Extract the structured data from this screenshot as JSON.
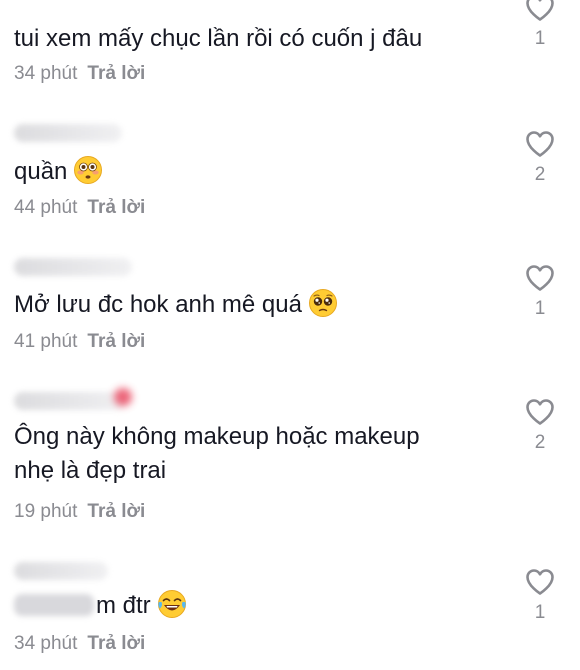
{
  "reply_label": "Trả lời",
  "comments": [
    {
      "text": "tui xem mấy chục lần rồi có cuốn j đâu",
      "time": "34 phút",
      "likes": "1",
      "emoji": ""
    },
    {
      "text": "quần",
      "time": "44 phút",
      "likes": "2",
      "emoji": "flushed-face"
    },
    {
      "text": "Mở lưu đc hok anh mê quá",
      "time": "41 phút",
      "likes": "1",
      "emoji": "pleading-face"
    },
    {
      "text": "Ông này không makeup hoặc makeup\nnhẹ là đẹp trai",
      "time": "19 phút",
      "likes": "2",
      "emoji": ""
    },
    {
      "text": "m đtr",
      "time": "34 phút",
      "likes": "1",
      "emoji": "tears-of-joy-face"
    }
  ],
  "colors": {
    "text": "#161823",
    "muted": "#8a8b91"
  }
}
